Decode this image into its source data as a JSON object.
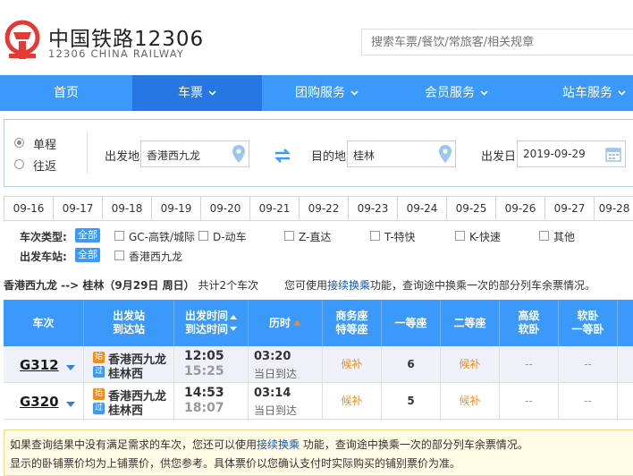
{
  "header": {
    "brand_cn": "中国铁路12306",
    "brand_en": "12306 CHINA RAILWAY",
    "search_placeholder": "搜索车票/餐饮/常旅客/相关规章"
  },
  "nav": [
    {
      "label": "首页",
      "chevron": false
    },
    {
      "label": "车票",
      "chevron": true
    },
    {
      "label": "团购服务",
      "chevron": true
    },
    {
      "label": "会员服务",
      "chevron": true
    },
    {
      "label": "站车服务",
      "chevron": true
    }
  ],
  "query": {
    "oneway": "单程",
    "roundtrip": "往返",
    "from_label": "出发地",
    "from_value": "香港西九龙",
    "to_label": "目的地",
    "to_value": "桂林",
    "date_label": "出发日",
    "date_value": "2019-09-29"
  },
  "dates": [
    "09-16",
    "09-17",
    "09-18",
    "09-19",
    "09-20",
    "09-21",
    "09-22",
    "09-23",
    "09-24",
    "09-25",
    "09-26",
    "09-27",
    "09-28"
  ],
  "filters": {
    "type_label": "车次类型:",
    "all": "全部",
    "types": [
      "GC-高铁/城际",
      "D-动车",
      "Z-直达",
      "T-特快",
      "K-快速",
      "其他"
    ],
    "station_label": "出发车站:",
    "stations": [
      "香港西九龙"
    ]
  },
  "route": {
    "text": "香港西九龙 --> 桂林（9月29日  周日）",
    "count": "共计2个车次",
    "tip_pre": "您可使用",
    "tip_link": "接续换乘",
    "tip_post": "功能，查询途中换乘一次的部分列车余票情况。"
  },
  "table_headers": [
    "车次",
    "出发站\n到达站",
    "出发时间\n到达时间",
    "历时",
    "商务座\n特等座",
    "一等座",
    "二等座",
    "高级\n软卧",
    "软卧\n一等卧"
  ],
  "trains": [
    {
      "code": "G312",
      "from": "香港西九龙",
      "to": "桂林西",
      "from_tag": "始",
      "to_tag": "过",
      "dep": "12:05",
      "arr": "15:25",
      "dur": "03:20",
      "arrive_note": "当日到达",
      "business": "候补",
      "first": "6",
      "second": "候补",
      "soft_hi": "--",
      "soft": "--"
    },
    {
      "code": "G320",
      "from": "香港西九龙",
      "to": "桂林西",
      "from_tag": "始",
      "to_tag": "过",
      "dep": "14:53",
      "arr": "18:07",
      "dur": "03:14",
      "arrive_note": "当日到达",
      "business": "候补",
      "first": "5",
      "second": "候补",
      "soft_hi": "--",
      "soft": "--"
    }
  ],
  "notice": {
    "line1_pre": "如果查询结果中没有满足需求的车次，您还可以使用",
    "line1_link": "接续换乘",
    "line1_post": " 功能，查询途中换乘一次的部分列车余票情况。",
    "line2": "显示的卧铺票价均为上铺票价，供您参考。具体票价以您确认支付时实际购买的铺别票价为准。"
  },
  "colors": {
    "blue": "#3b99fc",
    "nav_active": "#2676e3",
    "orange": "#f48c1a",
    "logo_red": "#e53935"
  }
}
